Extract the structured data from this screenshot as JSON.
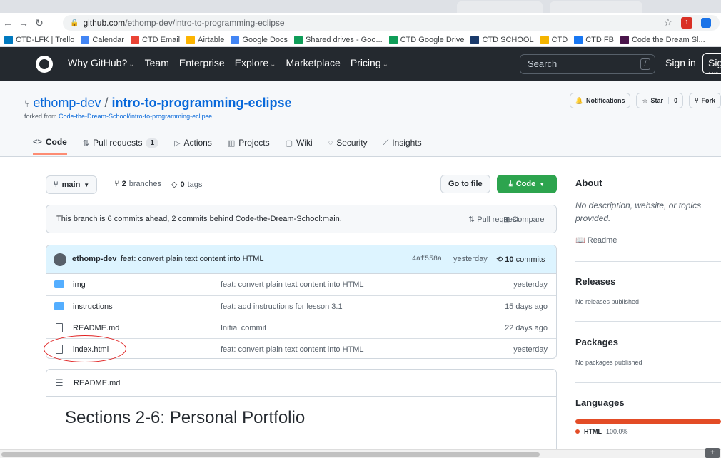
{
  "browser": {
    "url_host": "github.com",
    "url_path": "/ethomp-dev/intro-to-programming-eclipse",
    "ext_badge": "1",
    "bookmarks": [
      {
        "label": "CTD-LFK | Trello",
        "color": "#0079bf"
      },
      {
        "label": "Calendar",
        "color": "#4285f4"
      },
      {
        "label": "CTD Email",
        "color": "#ea4335"
      },
      {
        "label": "Airtable",
        "color": "#fcb400"
      },
      {
        "label": "Google Docs",
        "color": "#4285f4"
      },
      {
        "label": "Shared drives - Goo...",
        "color": "#0f9d58"
      },
      {
        "label": "CTD Google Drive",
        "color": "#0f9d58"
      },
      {
        "label": "CTD SCHOOL",
        "color": "#1a3a6b"
      },
      {
        "label": "CTD",
        "color": "#f4b400"
      },
      {
        "label": "CTD FB",
        "color": "#1877f2"
      },
      {
        "label": "Code the Dream Sl...",
        "color": "#4a154b"
      }
    ],
    "bookmarks_more": "»"
  },
  "gh_header": {
    "nav": [
      "Why GitHub?",
      "Team",
      "Enterprise",
      "Explore",
      "Marketplace",
      "Pricing"
    ],
    "search_placeholder": "Search",
    "search_key": "/",
    "signin": "Sign in",
    "signup": "Sign up"
  },
  "repo": {
    "owner": "ethomp-dev",
    "sep": " / ",
    "name": "intro-to-programming-eclipse",
    "forked_prefix": "forked from ",
    "forked_from": "Code-the-Dream-School/intro-to-programming-eclipse",
    "notifications": "Notifications",
    "star": "Star",
    "star_count": "0",
    "fork": "Fork"
  },
  "tabs": [
    {
      "label": "Code",
      "icon": "<>",
      "selected": true
    },
    {
      "label": "Pull requests",
      "icon": "⇅",
      "count": "1"
    },
    {
      "label": "Actions",
      "icon": "▷"
    },
    {
      "label": "Projects",
      "icon": "▥"
    },
    {
      "label": "Wiki",
      "icon": "▢"
    },
    {
      "label": "Security",
      "icon": "◌"
    },
    {
      "label": "Insights",
      "icon": "⟋"
    }
  ],
  "branch": {
    "current": "main",
    "branches_count": "2",
    "branches_label": "branches",
    "tags_count": "0",
    "tags_label": "tags",
    "go_to_file": "Go to file",
    "code": "Code"
  },
  "ahead": {
    "message": "This branch is 6 commits ahead, 2 commits behind Code-the-Dream-School:main.",
    "pull_request": "Pull request",
    "compare": "Compare"
  },
  "commit": {
    "author": "ethomp-dev",
    "message": "feat: convert plain text content into HTML",
    "sha": "4af558a",
    "when": "yesterday",
    "count": "10",
    "count_label": "commits"
  },
  "files": [
    {
      "name": "img",
      "type": "dir",
      "message": "feat: convert plain text content into HTML",
      "date": "yesterday"
    },
    {
      "name": "instructions",
      "type": "dir",
      "message": "feat: add instructions for lesson 3.1",
      "date": "15 days ago"
    },
    {
      "name": "README.md",
      "type": "file",
      "message": "Initial commit",
      "date": "22 days ago"
    },
    {
      "name": "index.html",
      "type": "file",
      "message": "feat: convert plain text content into HTML",
      "date": "yesterday"
    }
  ],
  "readme": {
    "filename": "README.md",
    "heading": "Sections 2-6: Personal Portfolio"
  },
  "sidebar": {
    "about_title": "About",
    "about_desc": "No description, website, or topics provided.",
    "readme_link": "Readme",
    "releases_title": "Releases",
    "releases_desc": "No releases published",
    "packages_title": "Packages",
    "packages_desc": "No packages published",
    "languages_title": "Languages",
    "language": "HTML",
    "language_pct": "100.0%",
    "language_color": "#e34c26",
    "language_share": 1.0
  }
}
